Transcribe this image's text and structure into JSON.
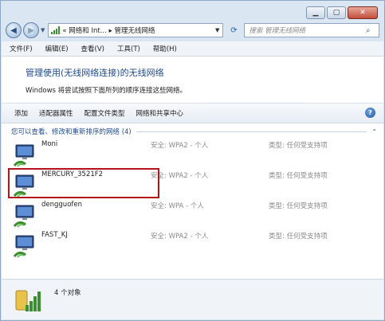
{
  "address": {
    "path_part1": "网络和 Int...",
    "path_part2": "管理无线网络",
    "search_placeholder": "搜索 管理无线网络"
  },
  "menu": [
    "文件(F)",
    "编辑(E)",
    "查看(V)",
    "工具(T)",
    "帮助(H)"
  ],
  "heading": "管理使用(无线网络连接)的无线网络",
  "description": "Windows 将尝试按照下面所列的顺序连接这些网络。",
  "toolbar": [
    "添加",
    "适配器属性",
    "配置文件类型",
    "网络和共享中心"
  ],
  "group_title": "您可以查看、修改和重新排序的网络 (4)",
  "networks": [
    {
      "name": "Moni",
      "security": "安全: WPA2 - 个人",
      "type": "类型: 任何受支持项"
    },
    {
      "name": "MERCURY_3521F2",
      "security": "安全: WPA2 - 个人",
      "type": "类型: 任何受支持项"
    },
    {
      "name": "dengguofen",
      "security": "安全: WPA - 个人",
      "type": "类型: 任何受支持项"
    },
    {
      "name": "FAST_KJ",
      "security": "安全: WPA2 - 个人",
      "type": "类型: 任何受支持项"
    }
  ],
  "status_text": "4 个对象",
  "colors": {
    "accent_text": "#1e4b8f",
    "highlight": "#b3141c",
    "signal_green": "#3a8f2e"
  }
}
